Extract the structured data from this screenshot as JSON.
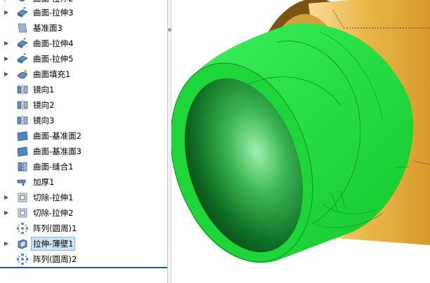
{
  "feature_tree": {
    "items": [
      {
        "label": "曲面-拉伸3",
        "expandable": true,
        "icon": "surface-extrude-icon",
        "selected": false
      },
      {
        "label": "基准面3",
        "expandable": false,
        "icon": "plane-icon",
        "selected": false
      },
      {
        "label": "曲面-拉伸4",
        "expandable": true,
        "icon": "surface-extrude-icon",
        "selected": false
      },
      {
        "label": "曲面-拉伸5",
        "expandable": true,
        "icon": "surface-extrude-icon",
        "selected": false
      },
      {
        "label": "曲面填充1",
        "expandable": true,
        "icon": "surface-fill-icon",
        "selected": false
      },
      {
        "label": "镜向1",
        "expandable": false,
        "icon": "mirror-icon",
        "selected": false
      },
      {
        "label": "镜向2",
        "expandable": false,
        "icon": "mirror-icon",
        "selected": false
      },
      {
        "label": "镜向3",
        "expandable": false,
        "icon": "mirror-icon",
        "selected": false
      },
      {
        "label": "曲面-基准面2",
        "expandable": false,
        "icon": "surface-plane-icon",
        "selected": false
      },
      {
        "label": "曲面-基准面3",
        "expandable": false,
        "icon": "surface-plane-icon",
        "selected": false
      },
      {
        "label": "曲面-缝合1",
        "expandable": false,
        "icon": "knit-icon",
        "selected": false
      },
      {
        "label": "加厚1",
        "expandable": false,
        "icon": "thicken-icon",
        "selected": false
      },
      {
        "label": "切除-拉伸1",
        "expandable": true,
        "icon": "cut-extrude-icon",
        "selected": false
      },
      {
        "label": "切除-拉伸2",
        "expandable": true,
        "icon": "cut-extrude-icon",
        "selected": false
      },
      {
        "label": "阵列(圆周)1",
        "expandable": false,
        "icon": "circular-pattern-icon",
        "selected": false
      },
      {
        "label": "拉伸-薄壁1",
        "expandable": true,
        "icon": "thin-extrude-icon",
        "selected": true
      },
      {
        "label": "阵列(圆周)2",
        "expandable": false,
        "icon": "circular-pattern-icon",
        "selected": false
      }
    ]
  },
  "colors": {
    "highlight_green": "#22e03c",
    "body_gold": "#e8b84a",
    "selection_bg": "#cde4f7"
  }
}
